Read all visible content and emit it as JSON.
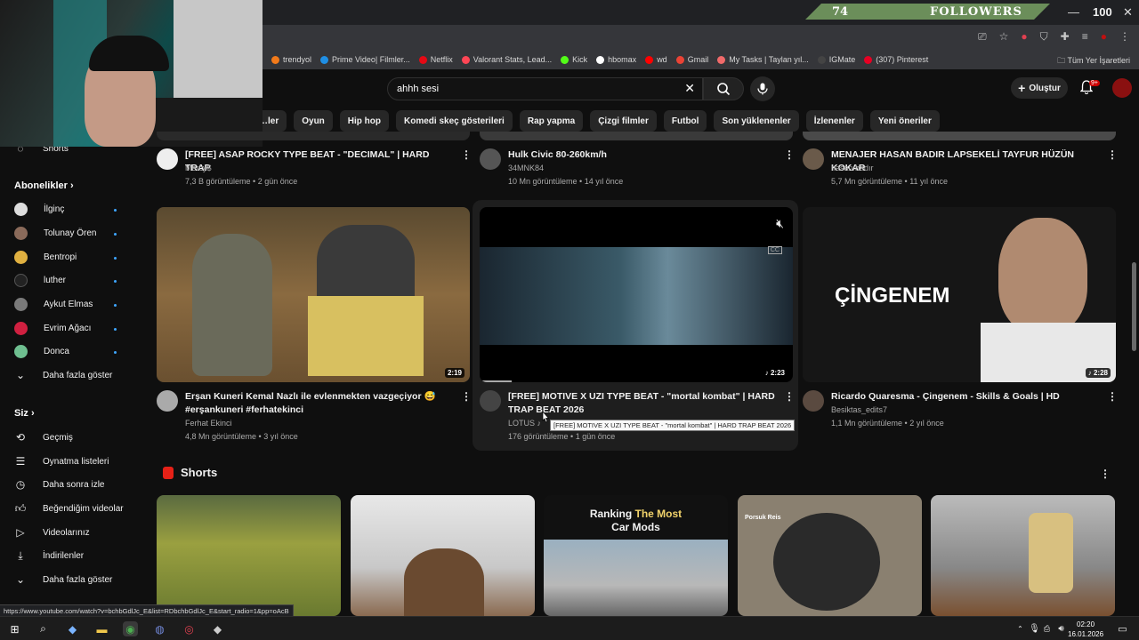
{
  "overlay": {
    "followers_count": "74",
    "followers_label": "FOLLOWERS",
    "score": "100"
  },
  "bookmarks": [
    {
      "label": "trendyol",
      "color": "#f27a1a"
    },
    {
      "label": "Prime Video| Filmler...",
      "color": "#1f8fe5"
    },
    {
      "label": "Netflix",
      "color": "#e50914"
    },
    {
      "label": "Valorant Stats, Lead...",
      "color": "#ff4655"
    },
    {
      "label": "Kick",
      "color": "#53fc18"
    },
    {
      "label": "hbomax",
      "color": "#ffffff"
    },
    {
      "label": "wd",
      "color": "#ff0000"
    },
    {
      "label": "Gmail",
      "color": "#ea4335"
    },
    {
      "label": "My Tasks | Taylan yıl...",
      "color": "#f06a6a"
    },
    {
      "label": "IGMate",
      "color": "#444444"
    },
    {
      "label": "(307) Pinterest",
      "color": "#e60023"
    }
  ],
  "bookmarks_right": "Tüm Yer İşaretleri",
  "header": {
    "search_value": "ahhh sesi",
    "create_label": "Oluştur",
    "notif_count": "9+"
  },
  "chips": [
    "…ler",
    "Oyun",
    "Hip hop",
    "Komedi skeç gösterileri",
    "Rap yapma",
    "Çizgi filmler",
    "Futbol",
    "Son yüklenenler",
    "İzlenenler",
    "Yeni öneriler"
  ],
  "sidebar": {
    "shorts_label": "Shorts",
    "subs_heading": "Abonelikler",
    "subs": [
      {
        "label": "İlginç",
        "color": "#dddddd"
      },
      {
        "label": "Tolunay Ören",
        "color": "#8a6a5a"
      },
      {
        "label": "Bentropi",
        "color": "#e0b040"
      },
      {
        "label": "luther",
        "color": "#222222"
      },
      {
        "label": "Aykut Elmas",
        "color": "#7a7a7a"
      },
      {
        "label": "Evrim Ağacı",
        "color": "#d02040"
      },
      {
        "label": "Donca",
        "color": "#6fbf90"
      }
    ],
    "subs_more": "Daha fazla göster",
    "you_heading": "Siz",
    "you_items": [
      "Geçmiş",
      "Oynatma listeleri",
      "Daha sonra izle",
      "Beğendiğim videolar",
      "Videolarınız",
      "İndirilenler",
      "Daha fazla göster"
    ]
  },
  "videos_top": [
    {
      "title": "[FREE] ASAP ROCKY TYPE BEAT - \"DECIMAL\" | HARD TRAP",
      "channel": "Mercy$",
      "meta": "7,3 B görüntüleme • 2 gün önce"
    },
    {
      "title": "Hulk Civic 80-260km/h",
      "channel": "34MNK84",
      "meta": "10 Mn görüntüleme • 14 yıl önce"
    },
    {
      "title": "MENAJER HASAN BADIR LAPSEKELİ TAYFUR HÜZÜN KOKAR",
      "channel": "hasan badır",
      "meta": "5,7 Mn görüntüleme • 11 yıl önce"
    }
  ],
  "videos_mid": [
    {
      "title": "Erşan Kuneri Kemal Nazlı ile evlenmekten vazgeçiyor 😅 #erşankuneri #ferhatekinci",
      "channel": "Ferhat Ekinci",
      "meta": "4,8 Mn görüntüleme • 3 yıl önce",
      "duration": "2:19"
    },
    {
      "title": "[FREE] MOTIVE X UZI TYPE BEAT - \"mortal kombat\" | HARD TRAP BEAT 2026",
      "channel": "LOTUS ♪",
      "meta": "176 görüntüleme • 1 gün önce",
      "duration": "2:23",
      "tooltip": "[FREE] MOTIVE X UZI TYPE BEAT - \"mortal kombat\" | HARD TRAP BEAT 2026"
    },
    {
      "title": "Ricardo Quaresma - Çingenem - Skills & Goals | HD",
      "channel": "Besiktas_edits7",
      "meta": "1,1 Mn görüntüleme • 2 yıl önce",
      "duration": "2:28",
      "thumb_text": "ÇİNGENEM"
    }
  ],
  "shorts": {
    "heading": "Shorts",
    "items": [
      {
        "label": ""
      },
      {
        "label": ""
      },
      {
        "label": "Ranking The Most Car Mods",
        "label_a": "Ranking ",
        "label_b": "The Most",
        "label_c": "Car Mods"
      },
      {
        "label": "Porsuk Reis"
      },
      {
        "label": ""
      }
    ]
  },
  "statusbar_url": "https://www.youtube.com/watch?v=bchbGdlJc_E&list=RDbchbGdlJc_E&start_radio=1&pp=oAcB",
  "taskbar": {
    "time": "02:20",
    "date": "16.01.2026"
  }
}
